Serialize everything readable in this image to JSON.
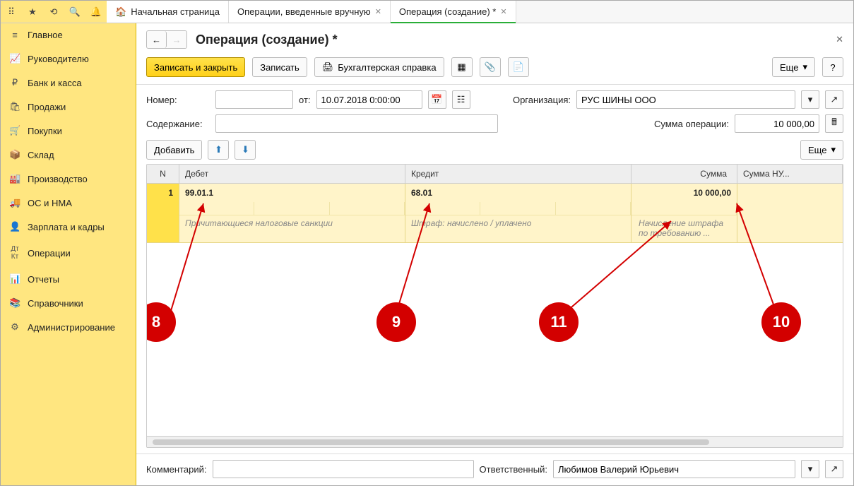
{
  "tabs": {
    "t1": "Начальная страница",
    "t2": "Операции, введенные вручную",
    "t3": "Операция (создание) *"
  },
  "sidebar": {
    "items": [
      {
        "icon": "≡",
        "label": "Главное"
      },
      {
        "icon": "↗",
        "label": "Руководителю"
      },
      {
        "icon": "₽",
        "label": "Банк и касса"
      },
      {
        "icon": "🛍",
        "label": "Продажи"
      },
      {
        "icon": "🛒",
        "label": "Покупки"
      },
      {
        "icon": "📦",
        "label": "Склад"
      },
      {
        "icon": "🏭",
        "label": "Производство"
      },
      {
        "icon": "🚚",
        "label": "ОС и НМА"
      },
      {
        "icon": "👤",
        "label": "Зарплата и кадры"
      },
      {
        "icon": "Дт",
        "label": "Операции"
      },
      {
        "icon": "📊",
        "label": "Отчеты"
      },
      {
        "icon": "📚",
        "label": "Справочники"
      },
      {
        "icon": "⚙",
        "label": "Администрирование"
      }
    ]
  },
  "page": {
    "title": "Операция (создание) *"
  },
  "toolbar": {
    "save_close": "Записать и закрыть",
    "save": "Записать",
    "report": "Бухгалтерская справка",
    "more": "Еще",
    "help": "?"
  },
  "form": {
    "number_label": "Номер:",
    "number_value": "",
    "from_label": "от:",
    "date_value": "10.07.2018 0:00:00",
    "org_label": "Организация:",
    "org_value": "РУС ШИНЫ ООО",
    "content_label": "Содержание:",
    "content_value": "",
    "sum_label": "Сумма операции:",
    "sum_value": "10 000,00"
  },
  "tablebar": {
    "add": "Добавить",
    "more": "Еще"
  },
  "table": {
    "headers": {
      "n": "N",
      "debit": "Дебет",
      "credit": "Кредит",
      "sum": "Сумма",
      "sum_nu": "Сумма НУ..."
    },
    "row": {
      "n": "1",
      "debit_acc": "99.01.1",
      "debit_desc": "Причитающиеся налоговые санкции",
      "credit_acc": "68.01",
      "credit_desc": "Штраф: начислено / уплачено",
      "sum": "10 000,00",
      "sum_desc": "Начисление штрафа по требованию ..."
    }
  },
  "footer": {
    "comment_label": "Комментарий:",
    "comment_value": "",
    "resp_label": "Ответственный:",
    "resp_value": "Любимов Валерий Юрьевич"
  },
  "annotations": {
    "a8": "8",
    "a9": "9",
    "a10": "10",
    "a11": "11"
  }
}
